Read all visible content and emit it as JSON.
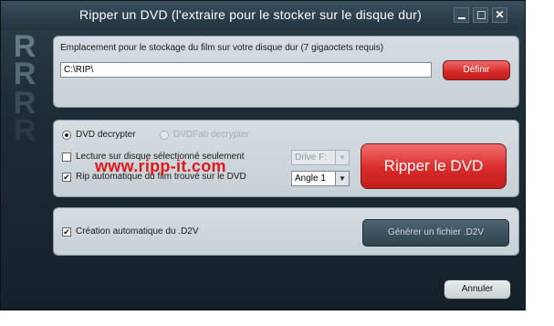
{
  "window": {
    "title": "Ripper un DVD (l'extraire pour le stocker sur le disque dur)",
    "minimize_icon": "minimize-icon",
    "maximize_icon": "maximize-icon",
    "close_icon": "close-icon"
  },
  "side_logo": {
    "letters": [
      "R",
      "R",
      "R",
      "R"
    ]
  },
  "storage": {
    "label": "Emplacement pour le stockage du film sur votre disque dur (7 gigaoctets requis)",
    "path_value": "C:\\RIP\\",
    "define_button": "Définir"
  },
  "options": {
    "decrypter_dvd": "DVD decrypter",
    "decrypter_dvdfab": "DVDFab decrypter",
    "read_selected_only": "Lecture sur disque sélectionné seulement",
    "auto_rip": "Rip automatique du film trouvé sur le DVD",
    "drive_select": "Drive F:",
    "angle_select": "Angle 1",
    "rip_button": "Ripper le DVD"
  },
  "watermark": "www.ripp-it.com",
  "d2v": {
    "auto_create": "Création automatique du .D2V",
    "generate_button": "Générer un fichier .D2V"
  },
  "footer": {
    "cancel_button": "Annuler"
  },
  "state": {
    "dvd_decrypter_selected": true,
    "dvdfab_disabled": true,
    "read_selected_checked": false,
    "auto_rip_checked": true,
    "auto_d2v_checked": true
  },
  "colors": {
    "accent_red": "#d92b2b",
    "panel_bg": "#d6dde2",
    "window_bg": "#1d2c37"
  }
}
